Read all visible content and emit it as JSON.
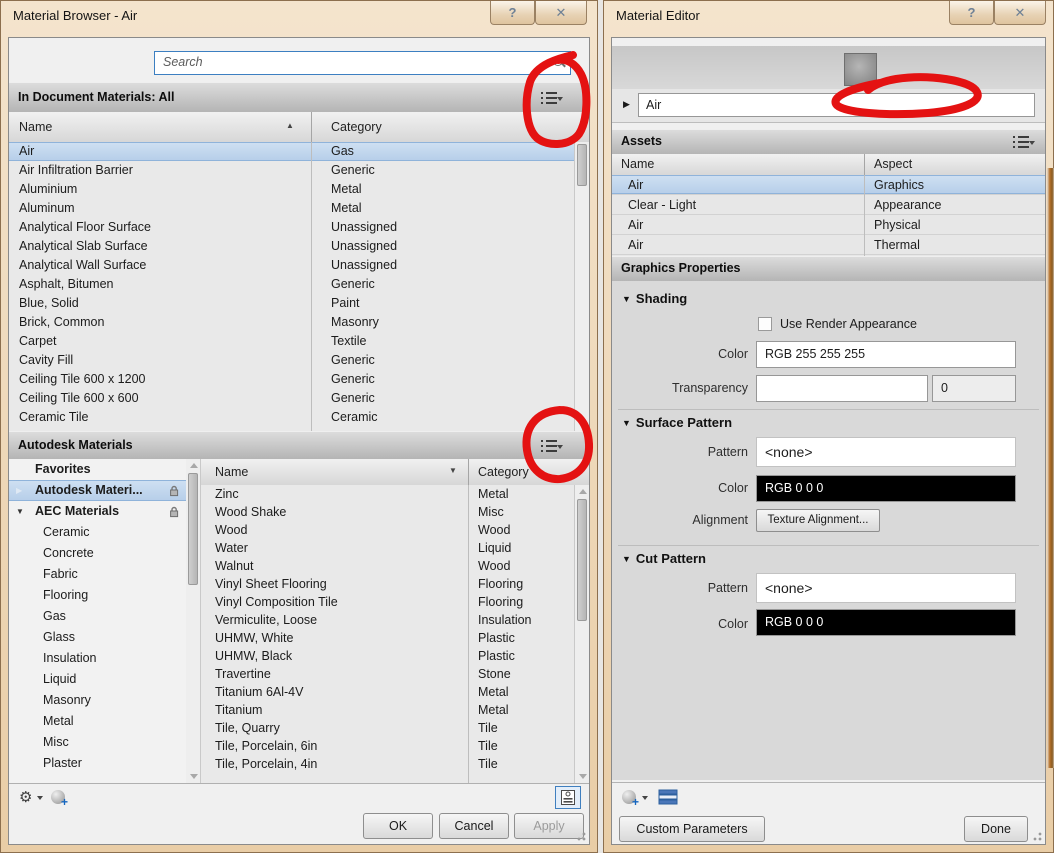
{
  "icons": {
    "help": "?",
    "close": "✕",
    "sort_asc": "▲",
    "sort_desc": "▼",
    "tree_collapsed": "▶",
    "tree_expanded": "▼",
    "section_collapse": "▼",
    "gear": "⚙"
  },
  "left_window": {
    "title": "Material Browser - Air",
    "search": {
      "placeholder": "Search"
    },
    "doc_section": {
      "header": "In Document Materials: All",
      "columns": {
        "name": "Name",
        "category": "Category"
      },
      "rows": [
        {
          "name": "Air",
          "category": "Gas",
          "classes": "selected"
        },
        {
          "name": "Air Infiltration Barrier",
          "category": "Generic"
        },
        {
          "name": "Aluminium",
          "category": "Metal"
        },
        {
          "name": "Aluminum",
          "category": "Metal"
        },
        {
          "name": "Analytical Floor Surface",
          "category": "Unassigned"
        },
        {
          "name": "Analytical Slab Surface",
          "category": "Unassigned"
        },
        {
          "name": "Analytical Wall Surface",
          "category": "Unassigned"
        },
        {
          "name": "Asphalt, Bitumen",
          "category": "Generic"
        },
        {
          "name": "Blue, Solid",
          "category": "Paint"
        },
        {
          "name": "Brick, Common",
          "category": "Masonry"
        },
        {
          "name": "Carpet",
          "category": "Textile"
        },
        {
          "name": "Cavity Fill",
          "category": "Generic"
        },
        {
          "name": "Ceiling Tile 600 x 1200",
          "category": "Generic"
        },
        {
          "name": "Ceiling Tile 600 x 600",
          "category": "Generic"
        },
        {
          "name": "Ceramic Tile",
          "category": "Ceramic"
        }
      ]
    },
    "autodesk_section": {
      "header": "Autodesk Materials",
      "tree": [
        {
          "label": "Favorites",
          "classes": "bold"
        },
        {
          "label": "Autodesk Materi...",
          "classes": "bold selected",
          "lock": true,
          "arrow_right": true
        },
        {
          "label": "AEC Materials",
          "classes": "bold",
          "lock": true,
          "arrow_down": true
        },
        {
          "label": "Ceramic",
          "classes": "child"
        },
        {
          "label": "Concrete",
          "classes": "child"
        },
        {
          "label": "Fabric",
          "classes": "child"
        },
        {
          "label": "Flooring",
          "classes": "child"
        },
        {
          "label": "Gas",
          "classes": "child"
        },
        {
          "label": "Glass",
          "classes": "child"
        },
        {
          "label": "Insulation",
          "classes": "child"
        },
        {
          "label": "Liquid",
          "classes": "child"
        },
        {
          "label": "Masonry",
          "classes": "child"
        },
        {
          "label": "Metal",
          "classes": "child"
        },
        {
          "label": "Misc",
          "classes": "child"
        },
        {
          "label": "Plaster",
          "classes": "child"
        }
      ],
      "columns": {
        "name": "Name",
        "category": "Category"
      },
      "rows": [
        {
          "name": "Zinc",
          "category": "Metal"
        },
        {
          "name": "Wood Shake",
          "category": "Misc"
        },
        {
          "name": "Wood",
          "category": "Wood"
        },
        {
          "name": "Water",
          "category": "Liquid"
        },
        {
          "name": "Walnut",
          "category": "Wood"
        },
        {
          "name": "Vinyl Sheet Flooring",
          "category": "Flooring"
        },
        {
          "name": "Vinyl Composition Tile",
          "category": "Flooring"
        },
        {
          "name": "Vermiculite, Loose",
          "category": "Insulation"
        },
        {
          "name": "UHMW, White",
          "category": "Plastic"
        },
        {
          "name": "UHMW, Black",
          "category": "Plastic"
        },
        {
          "name": "Travertine",
          "category": "Stone"
        },
        {
          "name": "Titanium 6Al-4V",
          "category": "Metal"
        },
        {
          "name": "Titanium",
          "category": "Metal"
        },
        {
          "name": "Tile, Quarry",
          "category": "Tile"
        },
        {
          "name": "Tile, Porcelain, 6in",
          "category": "Tile"
        },
        {
          "name": "Tile, Porcelain, 4in",
          "category": "Tile"
        }
      ]
    },
    "buttons": {
      "ok": "OK",
      "cancel": "Cancel",
      "apply": "Apply"
    }
  },
  "right_window": {
    "title": "Material Editor",
    "name_field": {
      "value": "Air"
    },
    "assets": {
      "header": "Assets",
      "columns": {
        "name": "Name",
        "aspect": "Aspect"
      },
      "rows": [
        {
          "name": "Air",
          "aspect": "Graphics",
          "classes": "selected"
        },
        {
          "name": "Clear - Light",
          "aspect": "Appearance"
        },
        {
          "name": "Air",
          "aspect": "Physical"
        },
        {
          "name": "Air",
          "aspect": "Thermal"
        }
      ]
    },
    "graphics_properties": {
      "header": "Graphics Properties",
      "shading": {
        "title": "Shading",
        "use_render_appearance": "Use Render Appearance",
        "color_label": "Color",
        "color_value": "RGB 255 255 255",
        "transparency_label": "Transparency",
        "transparency_value": "0"
      },
      "surface_pattern": {
        "title": "Surface Pattern",
        "pattern_label": "Pattern",
        "pattern_value": "<none>",
        "color_label": "Color",
        "color_value": "RGB 0 0 0",
        "alignment_label": "Alignment",
        "alignment_button": "Texture Alignment..."
      },
      "cut_pattern": {
        "title": "Cut Pattern",
        "pattern_label": "Pattern",
        "pattern_value": "<none>",
        "color_label": "Color",
        "color_value": "RGB 0 0 0"
      }
    },
    "buttons": {
      "custom_parameters": "Custom Parameters",
      "done": "Done"
    }
  },
  "colors": {
    "annotation_red": "#e41212",
    "selection_blue": "#b6cee9",
    "titlebar_tan": "#e9cda6",
    "swatch_white": "RGB 255 255 255",
    "swatch_black": "RGB 0 0 0"
  }
}
